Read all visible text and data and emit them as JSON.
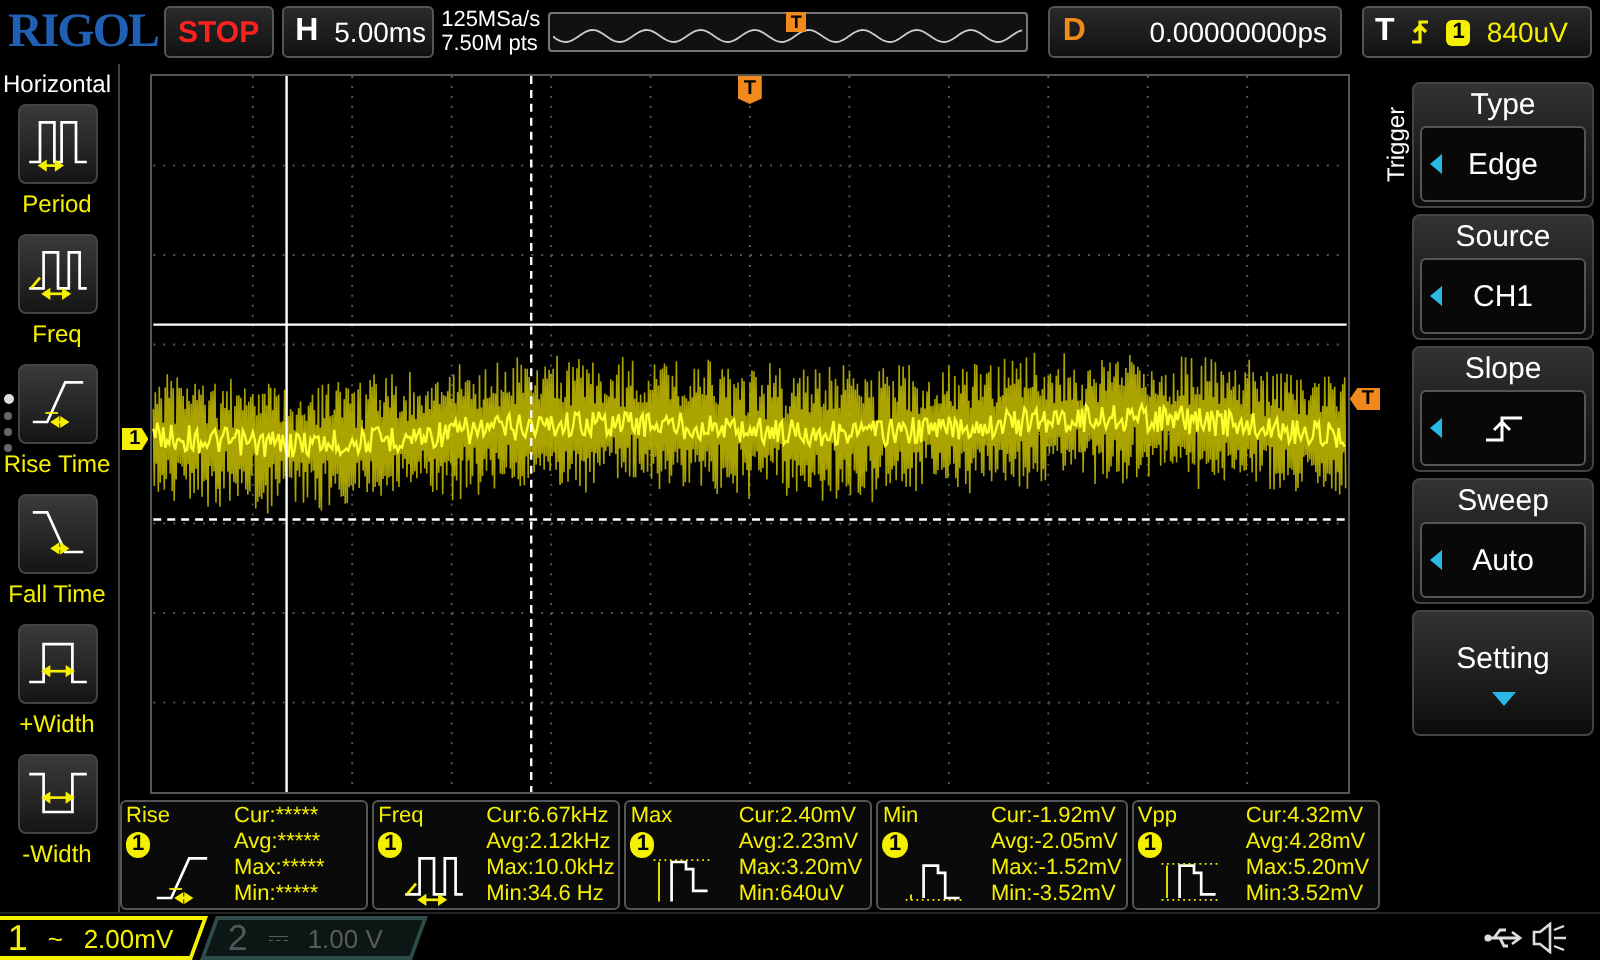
{
  "brand": "RIGOL",
  "run_state": "STOP",
  "horizontal": {
    "label": "H",
    "timebase": "5.00ms"
  },
  "acquisition": {
    "sample_rate": "125MSa/s",
    "memory_depth": "7.50M pts"
  },
  "timeline": {
    "marker": "T"
  },
  "delay": {
    "label": "D",
    "value": "0.00000000ps"
  },
  "trigger_status": {
    "label": "T",
    "source": "1",
    "threshold": "840uV"
  },
  "left_menu": {
    "title": "Horizontal",
    "pages": [
      {
        "selected": true
      },
      {
        "selected": false
      },
      {
        "selected": false
      },
      {
        "selected": false
      }
    ],
    "items": [
      {
        "label": "Period",
        "kind": "period"
      },
      {
        "label": "Freq",
        "kind": "freq"
      },
      {
        "label": "Rise Time",
        "kind": "rise"
      },
      {
        "label": "Fall Time",
        "kind": "fall"
      },
      {
        "label": "+Width",
        "kind": "pwidth"
      },
      {
        "label": "-Width",
        "kind": "nwidth"
      }
    ]
  },
  "screen": {
    "trigger_marker": "T",
    "channel_marker": "1",
    "trigger_level_marker": "T"
  },
  "right_menu": {
    "title": "Trigger",
    "items": [
      {
        "label": "Type",
        "kind": "value",
        "value": "Edge"
      },
      {
        "label": "Source",
        "kind": "value",
        "value": "CH1"
      },
      {
        "label": "Slope",
        "kind": "slope"
      },
      {
        "label": "Sweep",
        "kind": "value",
        "value": "Auto"
      },
      {
        "label": "Setting",
        "kind": "more"
      }
    ]
  },
  "measurements": [
    {
      "name": "Rise",
      "channel": "1",
      "kind": "rise",
      "lines": [
        "Cur:*****",
        "Avg:*****",
        "Max:*****",
        "Min:*****"
      ]
    },
    {
      "name": "Freq",
      "channel": "1",
      "kind": "freq",
      "lines": [
        "Cur:6.67kHz",
        "Avg:2.12kHz",
        "Max:10.0kHz",
        "Min:34.6 Hz"
      ]
    },
    {
      "name": "Max",
      "channel": "1",
      "kind": "max",
      "lines": [
        "Cur:2.40mV",
        "Avg:2.23mV",
        "Max:3.20mV",
        "Min:640uV"
      ]
    },
    {
      "name": "Min",
      "channel": "1",
      "kind": "min",
      "lines": [
        "Cur:-1.92mV",
        "Avg:-2.05mV",
        "Max:-1.52mV",
        "Min:-3.52mV"
      ]
    },
    {
      "name": "Vpp",
      "channel": "1",
      "kind": "vpp",
      "lines": [
        "Cur:4.32mV",
        "Avg:4.28mV",
        "Max:5.20mV",
        "Min:3.52mV"
      ]
    }
  ],
  "channels": [
    {
      "number": "1",
      "coupling": "~",
      "scale": "2.00mV",
      "active": true
    },
    {
      "number": "2",
      "coupling": "⎓",
      "scale": "1.00 V",
      "active": false
    }
  ]
}
